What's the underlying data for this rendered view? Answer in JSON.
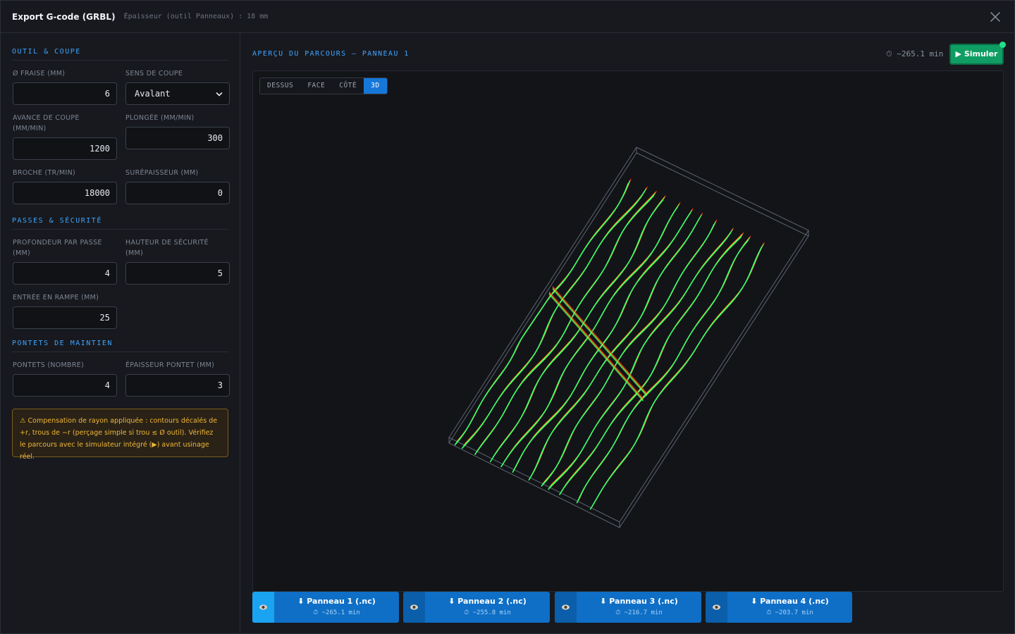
{
  "header": {
    "title": "Export G-code (GRBL)",
    "subtitle": "Épaisseur (outil Panneaux) : 18 mm"
  },
  "sections": {
    "tool": "OUTIL & COUPE",
    "passes": "PASSES & SÉCURITÉ",
    "tabs": "PONTETS DE MAINTIEN"
  },
  "fields": {
    "diameter": {
      "label": "Ø FRAISE (MM)",
      "value": "6"
    },
    "direction": {
      "label": "SENS DE COUPE",
      "value": "Avalant"
    },
    "feed": {
      "label": "AVANCE DE COUPE (MM/MIN)",
      "value": "1200"
    },
    "plunge": {
      "label": "PLONGÉE (MM/MIN)",
      "value": "300"
    },
    "spindle": {
      "label": "BROCHE (TR/MIN)",
      "value": "18000"
    },
    "stock": {
      "label": "SURÉPAISSEUR (MM)",
      "value": "0"
    },
    "depth": {
      "label": "PROFONDEUR PAR PASSE (MM)",
      "value": "4"
    },
    "safe": {
      "label": "HAUTEUR DE SÉCURITÉ (MM)",
      "value": "5"
    },
    "ramp": {
      "label": "ENTRÉE EN RAMPE (MM)",
      "value": "25"
    },
    "tab_count": {
      "label": "PONTETS (NOMBRE)",
      "value": "4"
    },
    "tab_thick": {
      "label": "ÉPAISSEUR PONTET (MM)",
      "value": "3"
    }
  },
  "warning": "⚠ Compensation de rayon appliquée : contours décalés de +r, trous de −r (perçage simple si trou ≤ Ø outil). Vérifiez le parcours avec le simulateur intégré (▶) avant usinage réel.",
  "preview": {
    "title": "APERÇU DU PARCOURS — PANNEAU 1",
    "time": "⏱ ~265.1 min",
    "simulate": "▶ Simuler",
    "view_tabs": [
      "DESSUS",
      "FACE",
      "CÔTÉ",
      "3D"
    ],
    "active_view": "3D"
  },
  "downloads": [
    {
      "label": "⬇ Panneau 1 (.nc)",
      "time": "⏱ ~265.1 min"
    },
    {
      "label": "⬇ Panneau 2 (.nc)",
      "time": "⏱ ~255.8 min"
    },
    {
      "label": "⬇ Panneau 3 (.nc)",
      "time": "⏱ ~216.7 min"
    },
    {
      "label": "⬇ Panneau 4 (.nc)",
      "time": "⏱ ~203.7 min"
    }
  ],
  "colors": {
    "accent": "#3fa3ff",
    "toolpath_green": "#3dff6a",
    "toolpath_red": "#e8321e",
    "toolpath_yellow": "#e6d21a",
    "simulate": "#0f9d63",
    "download": "#0f6fc6"
  },
  "icons": {
    "close": "close-icon",
    "eye": "eye-icon",
    "chevron": "chevron-down-icon"
  }
}
